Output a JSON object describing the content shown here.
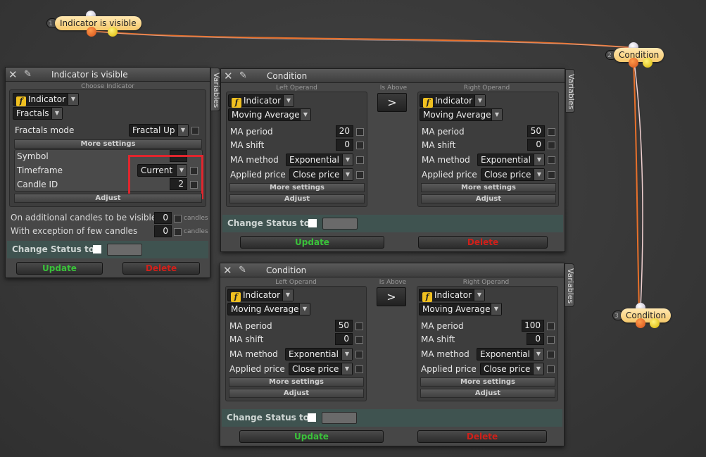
{
  "graph": {
    "nodes": [
      {
        "num": "1",
        "label": "Indicator is visible"
      },
      {
        "num": "2",
        "label": "Condition"
      },
      {
        "num": "3",
        "label": "Condition"
      }
    ]
  },
  "indicator_panel": {
    "title": "Indicator is visible",
    "variables_tab": "Variables",
    "choose_caption": "Choose Indicator",
    "indicator_label": "Indicator",
    "indicator_name": "Fractals",
    "fractals_mode_label": "Fractals mode",
    "fractals_mode_value": "Fractal Up",
    "more_settings": "More settings",
    "symbol_label": "Symbol",
    "symbol_value": "",
    "timeframe_label": "Timeframe",
    "timeframe_value": "Current",
    "candle_id_label": "Candle ID",
    "candle_id_value": "2",
    "adjust": "Adjust",
    "additional_label": "On additional candles to be visible",
    "additional_value": "0",
    "exception_label": "With exception of few candles",
    "exception_value": "0",
    "candles_unit": "candles",
    "change_status": "Change Status to",
    "update": "Update",
    "delete": "Delete"
  },
  "condition_panels": [
    {
      "title": "Condition",
      "variables_tab": "Variables",
      "left_caption": "Left Operand",
      "right_caption": "Right Operand",
      "operator_caption": "Is Above",
      "operator": ">",
      "left": {
        "indicator_label": "Indicator",
        "indicator_name": "Moving Average",
        "ma_period_label": "MA period",
        "ma_period": "20",
        "ma_shift_label": "MA shift",
        "ma_shift": "0",
        "ma_method_label": "MA method",
        "ma_method": "Exponential",
        "applied_price_label": "Applied price",
        "applied_price": "Close price",
        "more_settings": "More settings",
        "adjust": "Adjust"
      },
      "right": {
        "indicator_label": "Indicator",
        "indicator_name": "Moving Average",
        "ma_period_label": "MA period",
        "ma_period": "50",
        "ma_shift_label": "MA shift",
        "ma_shift": "0",
        "ma_method_label": "MA method",
        "ma_method": "Exponential",
        "applied_price_label": "Applied price",
        "applied_price": "Close price",
        "more_settings": "More settings",
        "adjust": "Adjust"
      },
      "change_status": "Change Status to",
      "update": "Update",
      "delete": "Delete"
    },
    {
      "title": "Condition",
      "variables_tab": "Variables",
      "left_caption": "Left Operand",
      "right_caption": "Right Operand",
      "operator_caption": "Is Above",
      "operator": ">",
      "left": {
        "indicator_label": "Indicator",
        "indicator_name": "Moving Average",
        "ma_period_label": "MA period",
        "ma_period": "50",
        "ma_shift_label": "MA shift",
        "ma_shift": "0",
        "ma_method_label": "MA method",
        "ma_method": "Exponential",
        "applied_price_label": "Applied price",
        "applied_price": "Close price",
        "more_settings": "More settings",
        "adjust": "Adjust"
      },
      "right": {
        "indicator_label": "Indicator",
        "indicator_name": "Moving Average",
        "ma_period_label": "MA period",
        "ma_period": "100",
        "ma_shift_label": "MA shift",
        "ma_shift": "0",
        "ma_method_label": "MA method",
        "ma_method": "Exponential",
        "applied_price_label": "Applied price",
        "applied_price": "Close price",
        "more_settings": "More settings",
        "adjust": "Adjust"
      },
      "change_status": "Change Status to",
      "update": "Update",
      "delete": "Delete"
    }
  ],
  "colors": {
    "node_fill": "#f6c96c",
    "wire_orange": "#e8702a",
    "wire_light": "#f0c8c8",
    "update_green": "#3ac23a",
    "delete_red": "#d0201a",
    "highlight_red": "#e0262e",
    "status_bar": "#3f5350"
  },
  "icons": [
    "close-icon",
    "pin-icon",
    "function-icon",
    "dropdown-arrow-icon"
  ]
}
